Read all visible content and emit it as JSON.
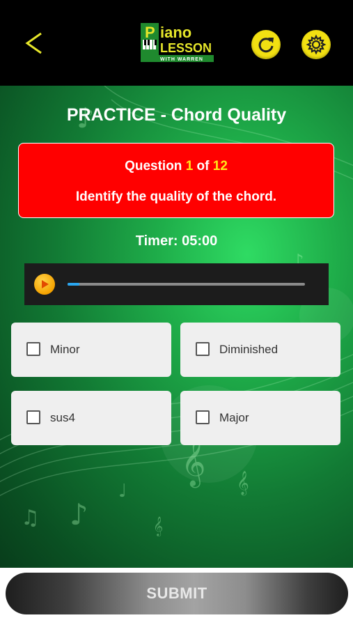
{
  "header": {
    "logo_top": "iano",
    "logo_mid": "LESSON",
    "logo_bottom": "WITH WARREN",
    "logo_letter": "P"
  },
  "main": {
    "title": "PRACTICE - Chord Quality",
    "question": {
      "prefix": "Question ",
      "current": "1",
      "of": " of ",
      "total": "12",
      "prompt": "Identify the quality of the chord."
    },
    "timer": "Timer: 05:00",
    "player": {
      "progress": 0.05
    },
    "options": [
      {
        "label": "Minor",
        "checked": false
      },
      {
        "label": "Diminished",
        "checked": false
      },
      {
        "label": "sus4",
        "checked": false
      },
      {
        "label": "Major",
        "checked": false
      }
    ]
  },
  "footer": {
    "submit_label": "SUBMIT"
  },
  "colors": {
    "accent_yellow": "#f2e012",
    "question_bg": "#ff0000",
    "progress_fill": "#2aa6f0"
  }
}
